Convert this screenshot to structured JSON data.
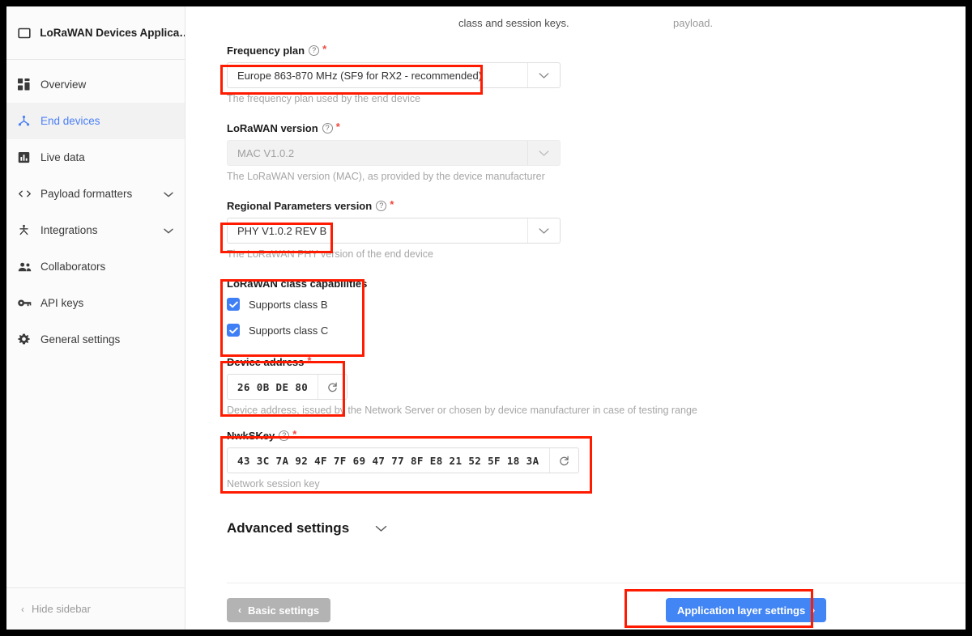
{
  "app": {
    "title": "LoRaWAN Devices Applica…",
    "title_icon": "window-icon"
  },
  "sidebar": {
    "items": [
      {
        "label": "Overview",
        "icon": "grid-icon",
        "active": false,
        "chevron": ""
      },
      {
        "label": "End devices",
        "icon": "device-tree-icon",
        "active": true,
        "chevron": ""
      },
      {
        "label": "Live data",
        "icon": "bar-chart-icon",
        "active": false,
        "chevron": ""
      },
      {
        "label": "Payload formatters",
        "icon": "code-icon",
        "active": false,
        "chevron": "⌄"
      },
      {
        "label": "Integrations",
        "icon": "integrations-icon",
        "active": false,
        "chevron": "⌄"
      },
      {
        "label": "Collaborators",
        "icon": "people-icon",
        "active": false,
        "chevron": ""
      },
      {
        "label": "API keys",
        "icon": "key-icon",
        "active": false,
        "chevron": ""
      },
      {
        "label": "General settings",
        "icon": "gear-icon",
        "active": false,
        "chevron": ""
      }
    ],
    "hide_sidebar": "Hide sidebar",
    "hide_chevron": "‹"
  },
  "top_cut_text": {
    "left": "class and session keys.",
    "right": "payload."
  },
  "form": {
    "frequency_plan": {
      "label": "Frequency plan",
      "required": "*",
      "help": "?",
      "value": "Europe 863-870 MHz (SF9 for RX2 - recommended)",
      "hint": "The frequency plan used by the end device",
      "disabled": false
    },
    "lorawan_version": {
      "label": "LoRaWAN version",
      "required": "*",
      "help": "?",
      "value": "MAC V1.0.2",
      "hint": "The LoRaWAN version (MAC), as provided by the device manufacturer",
      "disabled": true
    },
    "regional_parameters": {
      "label": "Regional Parameters version",
      "required": "*",
      "help": "?",
      "value": "PHY V1.0.2 REV B",
      "hint": "The LoRaWAN PHY version of the end device",
      "disabled": false
    },
    "class_capabilities": {
      "label": "LoRaWAN class capabilities",
      "options": [
        {
          "label": "Supports class B",
          "checked": true
        },
        {
          "label": "Supports class C",
          "checked": true
        }
      ]
    },
    "device_address": {
      "label": "Device address",
      "required": "*",
      "value": "26 0B DE 80",
      "hint": "Device address, issued by the Network Server or chosen by device manufacturer in case of testing range",
      "regenerate_icon": "refresh-icon"
    },
    "nwk_skey": {
      "label": "NwkSKey",
      "required": "*",
      "help": "?",
      "value": "43 3C 7A 92 4F 7F 69 47 77 8F E8 21 52 5F 18 3A",
      "hint": "Network session key",
      "regenerate_icon": "refresh-icon"
    },
    "advanced_settings": {
      "label": "Advanced settings",
      "chevron": "⌄"
    }
  },
  "footer": {
    "back_button": {
      "label": "Basic settings",
      "caret": "‹"
    },
    "next_button": {
      "label": "Application layer settings",
      "caret": "›"
    }
  },
  "colors": {
    "accent": "#4285f4",
    "annotation": "#ff1a00",
    "active_nav": "#4a7ff7",
    "checkbox": "#3f7ff5",
    "required": "#f0483e",
    "disabled_bg": "#f2f2f2"
  }
}
